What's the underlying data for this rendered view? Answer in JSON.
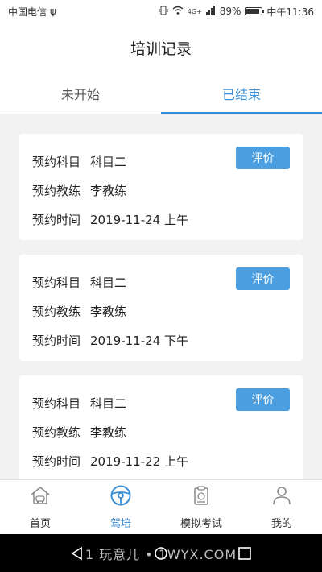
{
  "status_bar": {
    "carrier": "中国电信",
    "usb_symbol": "ψ",
    "network": "4G+",
    "battery": "89%",
    "battery_level": 0.89,
    "time": "中午11:36"
  },
  "header": {
    "title": "培训记录"
  },
  "tabs": [
    {
      "label": "未开始",
      "active": false
    },
    {
      "label": "已结束",
      "active": true
    }
  ],
  "records": [
    {
      "subject_label": "预约科目",
      "subject": "科目二",
      "coach_label": "预约教练",
      "coach": "李教练",
      "time_label": "预约时间",
      "time": "2019-11-24 上午",
      "button": "评价"
    },
    {
      "subject_label": "预约科目",
      "subject": "科目二",
      "coach_label": "预约教练",
      "coach": "李教练",
      "time_label": "预约时间",
      "time": "2019-11-24 下午",
      "button": "评价"
    },
    {
      "subject_label": "预约科目",
      "subject": "科目二",
      "coach_label": "预约教练",
      "coach": "李教练",
      "time_label": "预约时间",
      "time": "2019-11-22 上午",
      "button": "评价"
    }
  ],
  "tabbar": [
    {
      "label": "首页",
      "icon": "home-car-icon",
      "active": false
    },
    {
      "label": "驾培",
      "icon": "steering-wheel-icon",
      "active": true
    },
    {
      "label": "模拟考试",
      "icon": "exam-clipboard-icon",
      "active": false
    },
    {
      "label": "我的",
      "icon": "user-icon",
      "active": false
    }
  ],
  "watermark": "1 玩意儿 • 1WYX.COM",
  "colors": {
    "accent": "#3b8fd6",
    "button": "#4b9ee0",
    "background": "#f2f2f2"
  }
}
